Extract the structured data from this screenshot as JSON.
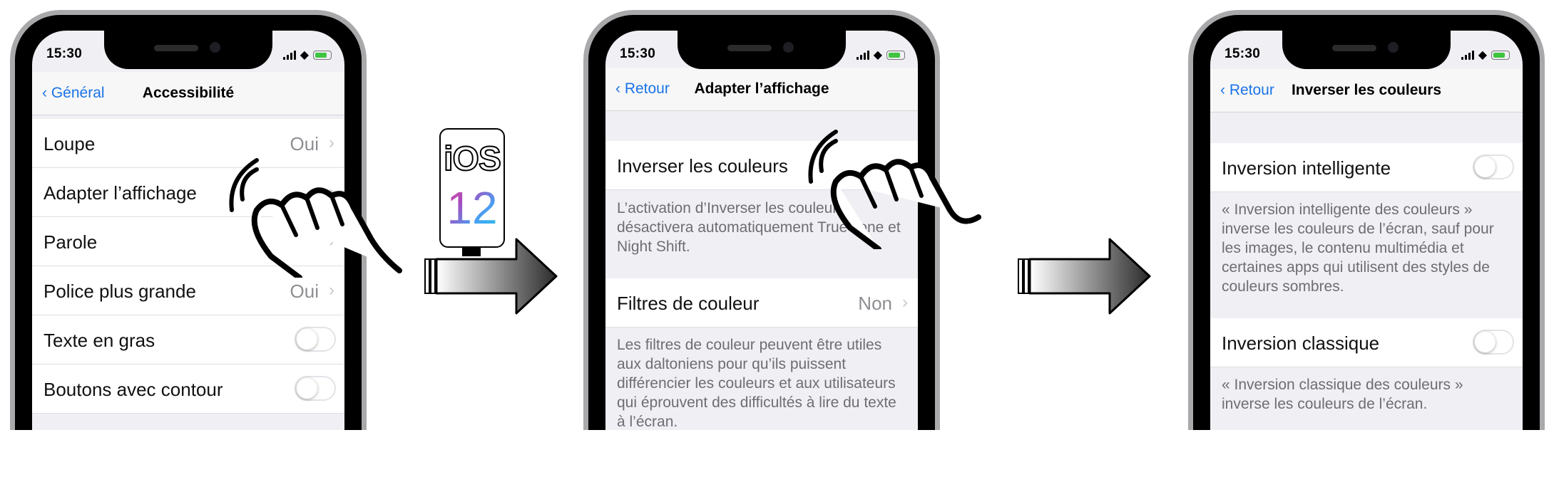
{
  "status": {
    "time": "15:30"
  },
  "badge": {
    "os": "iOS",
    "version": "12"
  },
  "screen1": {
    "back": "Général",
    "title": "Accessibilité",
    "rows": [
      {
        "label": "Loupe",
        "value": "Oui"
      },
      {
        "label": "Adapter l’affichage",
        "value": ""
      },
      {
        "label": "Parole",
        "value": ""
      },
      {
        "label": "Police plus grande",
        "value": "Oui"
      },
      {
        "label": "Texte en gras",
        "value": ""
      },
      {
        "label": "Boutons avec contour",
        "value": ""
      }
    ]
  },
  "screen2": {
    "back": "Retour",
    "title": "Adapter l’affichage",
    "row1": {
      "label": "Inverser les couleurs"
    },
    "footer1": "L’activation d’Inverser les couleurs désactivera automatiquement True Tone et Night Shift.",
    "row2": {
      "label": "Filtres de couleur",
      "value": "Non"
    },
    "footer2": "Les filtres de couleur peuvent être utiles aux daltoniens pour qu’ils puissent différencier les couleurs et aux utilisateurs qui éprouvent des difficultés à lire du texte à l’écran."
  },
  "screen3": {
    "back": "Retour",
    "title": "Inverser les couleurs",
    "row1": {
      "label": "Inversion intelligente"
    },
    "footer1": "« Inversion intelligente des couleurs » inverse les couleurs de l’écran, sauf pour les images, le contenu multimédia et certaines apps qui utilisent des styles de couleurs sombres.",
    "row2": {
      "label": "Inversion classique"
    },
    "footer2": "« Inversion classique des couleurs » inverse les couleurs de l’écran."
  }
}
